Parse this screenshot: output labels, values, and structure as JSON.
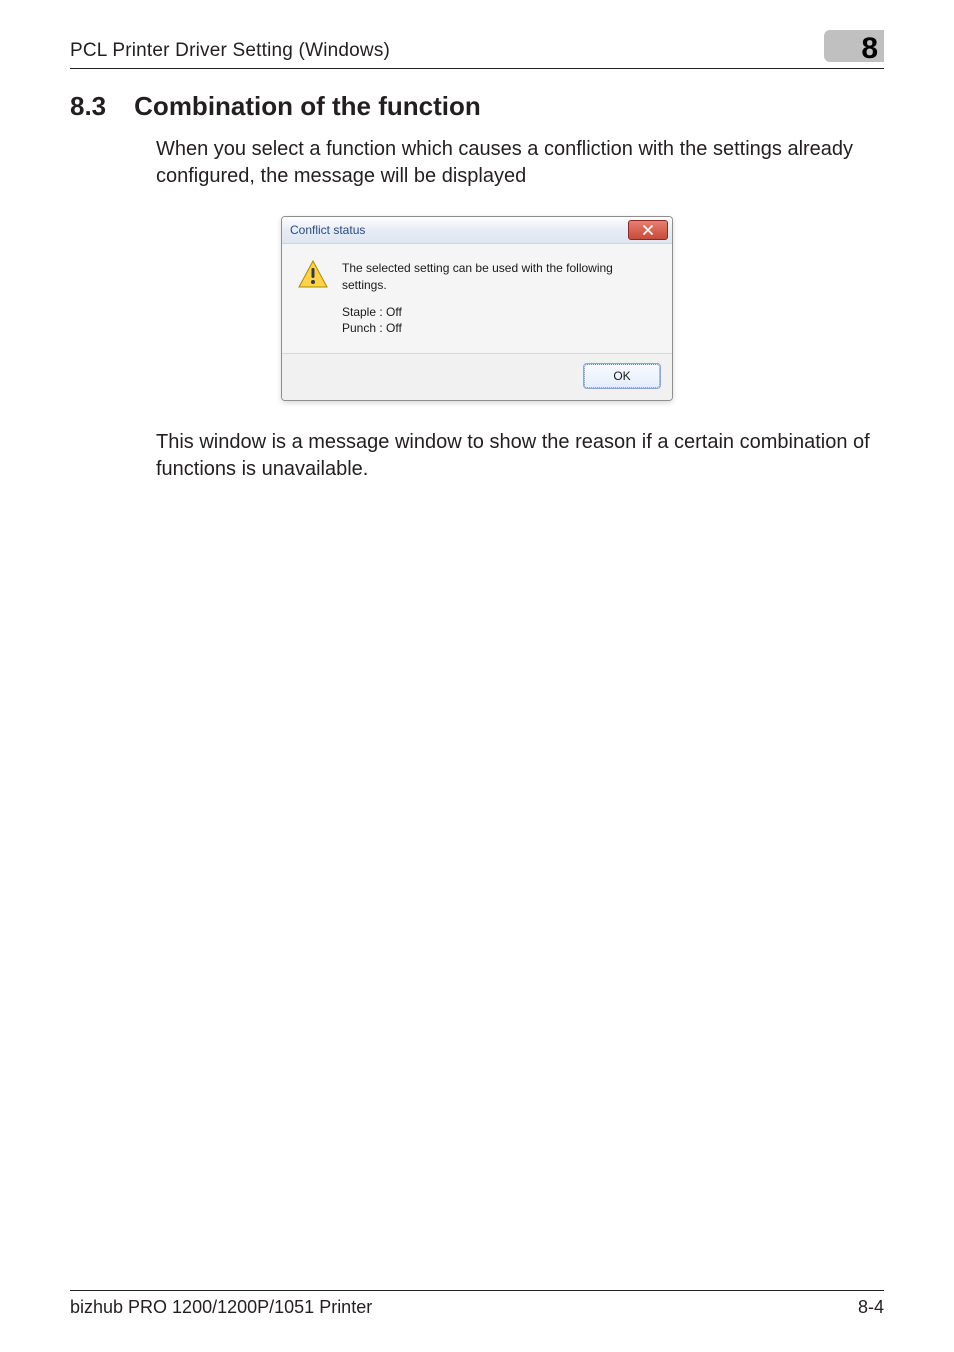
{
  "header": {
    "title": "PCL Printer Driver Setting (Windows)",
    "chapter_number": "8"
  },
  "section": {
    "number": "8.3",
    "title": "Combination of the function",
    "intro": "When you select a function which causes a confliction with the settings already configured, the message will be displayed",
    "outro": "This window is a message window to show the reason if a certain combination of functions is unavailable."
  },
  "dialog": {
    "title": "Conflict status",
    "message_main": "The selected setting can be used with the following settings.",
    "lines": [
      "Staple : Off",
      "Punch : Off"
    ],
    "ok_label": "OK"
  },
  "footer": {
    "product": "bizhub PRO 1200/1200P/1051 Printer",
    "page": "8-4"
  }
}
